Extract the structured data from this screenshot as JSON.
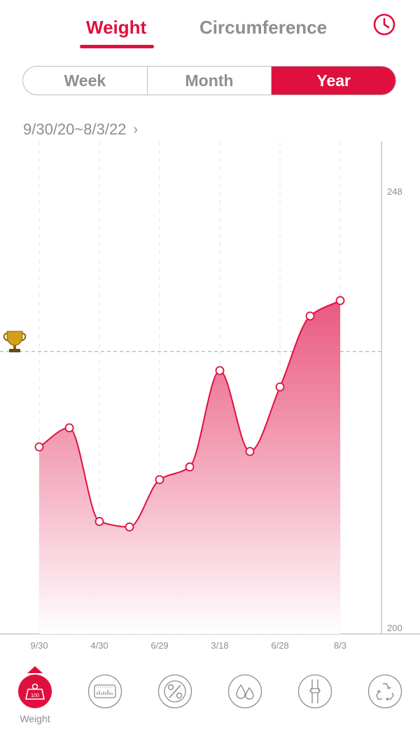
{
  "tabs": {
    "weight_label": "Weight",
    "circumference_label": "Circumference",
    "active": "Weight"
  },
  "period_selector": {
    "options": [
      "Week",
      "Month",
      "Year"
    ],
    "selected": "Year"
  },
  "date_range": {
    "text": "9/30/20~8/3/22",
    "chevron": "›"
  },
  "chart_data": {
    "type": "area",
    "title": "",
    "xlabel": "",
    "ylabel": "",
    "x_tick_labels": [
      "9/30",
      "4/30",
      "6/29",
      "3/18",
      "6/28",
      "8/3"
    ],
    "y_tick_labels": [
      "248",
      "200"
    ],
    "ylim": [
      200,
      248
    ],
    "goal_line": {
      "value": 230.3,
      "icon": "trophy-icon"
    },
    "series": [
      {
        "values": [
          219.8,
          221.9,
          211.6,
          211.0,
          216.2,
          217.6,
          228.2,
          219.3,
          226.4,
          234.2,
          235.9
        ]
      }
    ],
    "grid": true,
    "color": "#e0103e",
    "fill_gradient": [
      "#e8507a",
      "#ffffff"
    ]
  },
  "bottom_nav": {
    "items": [
      {
        "name": "weight",
        "label": "Weight",
        "icon": "weight-scale-icon",
        "badge": "100",
        "active": true
      },
      {
        "name": "body-composition",
        "label": "",
        "icon": "bar-chart-box-icon",
        "active": false
      },
      {
        "name": "body-fat",
        "label": "",
        "icon": "percent-icon",
        "active": false
      },
      {
        "name": "body-water",
        "label": "",
        "icon": "water-drops-icon",
        "active": false
      },
      {
        "name": "bone-mass",
        "label": "",
        "icon": "bone-joint-icon",
        "active": false
      },
      {
        "name": "metabolism",
        "label": "",
        "icon": "recycle-icon",
        "active": false
      }
    ]
  },
  "colors": {
    "accent": "#e0103e",
    "inactive_text": "#8e8e93",
    "border": "#bdbdbd"
  }
}
